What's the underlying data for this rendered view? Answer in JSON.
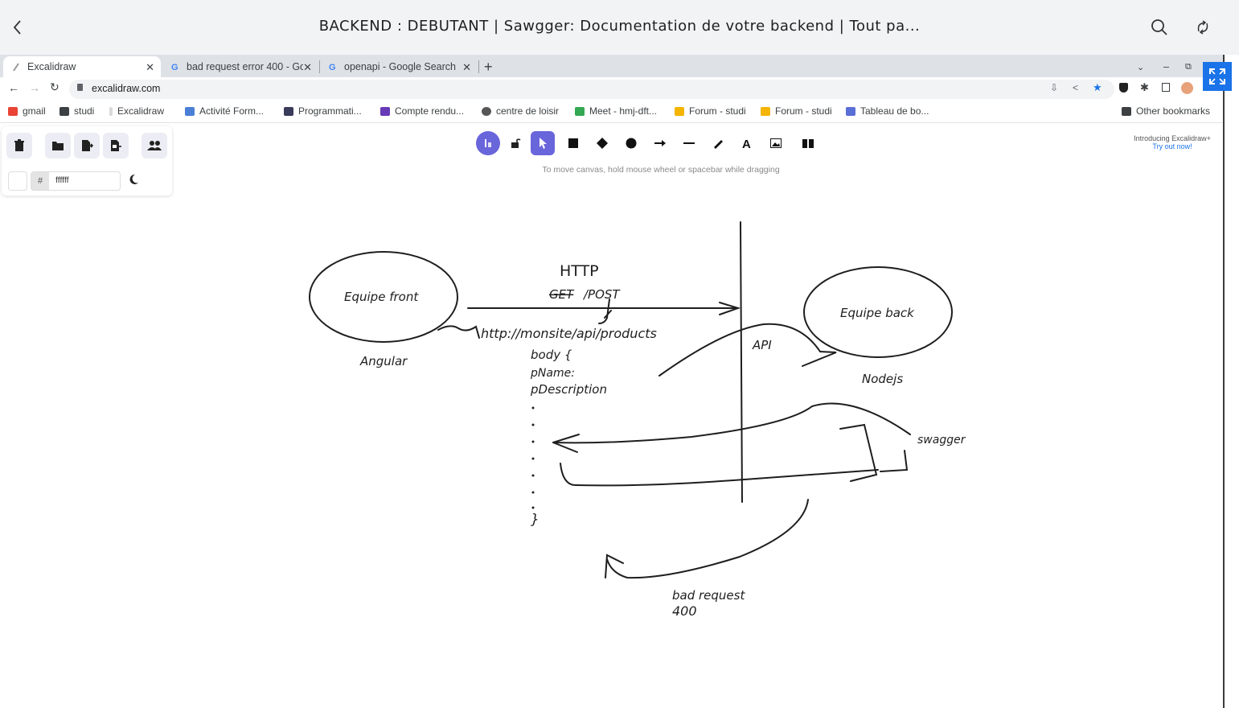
{
  "viewer": {
    "title": "BACKEND : DEBUTANT | Sawgger: Documentation de votre backend | Tout pa..."
  },
  "tabs": [
    {
      "label": "Excalidraw"
    },
    {
      "label": "bad request error 400 - Go"
    },
    {
      "label": "openapi - Google Search"
    }
  ],
  "address": {
    "url": "excalidraw.com"
  },
  "bookmarks": [
    {
      "label": "gmail"
    },
    {
      "label": "studi"
    },
    {
      "label": "Excalidraw"
    },
    {
      "label": "Activité Form..."
    },
    {
      "label": "Programmati..."
    },
    {
      "label": "Compte rendu..."
    },
    {
      "label": "centre de loisir"
    },
    {
      "label": "Meet - hmj-dft..."
    },
    {
      "label": "Forum - studi"
    },
    {
      "label": "Forum - studi"
    },
    {
      "label": "Tableau de bo..."
    },
    {
      "label": "Other bookmarks"
    }
  ],
  "excalidraw": {
    "color_hash": "#",
    "color_value": "ffffff",
    "hint": "To move canvas, hold mouse wheel or spacebar while dragging",
    "promo_line1": "Introducing Excalidraw+",
    "promo_line2": "Try out now!"
  },
  "drawing": {
    "http": "HTTP",
    "get_struck": "GET",
    "post": "/POST",
    "equipe_front": "Equipe front",
    "equipe_back": "Equipe back",
    "angular": "Angular",
    "nodejs": "Nodejs",
    "url": "http://monsite/api/products",
    "api": "API",
    "body": "body {",
    "pname": "pName:",
    "pdescription": "pDescription",
    "close_brace": "}",
    "swagger": "swagger",
    "bad_request": "bad request",
    "code_400": "400"
  },
  "colors": {
    "accent": "#6965db",
    "fullscreen": "#1a73e8",
    "star": "#1a73e8"
  }
}
